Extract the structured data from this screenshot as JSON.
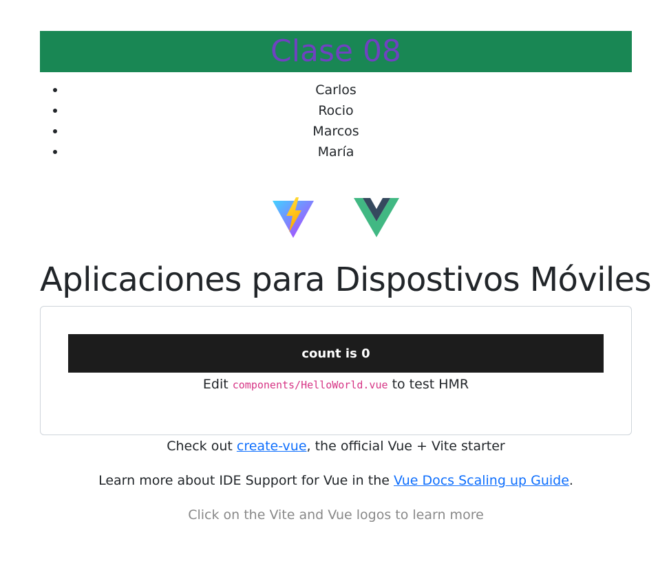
{
  "banner": {
    "title": "Clase 08"
  },
  "names": [
    "Carlos",
    "Rocio",
    "Marcos",
    "María"
  ],
  "logos": [
    {
      "name": "vite-logo"
    },
    {
      "name": "vue-logo"
    }
  ],
  "headline": "Aplicaciones para Dispostivos Móviles",
  "card": {
    "button_label": "count is 0",
    "edit_prefix": "Edit ",
    "edit_code": "components/HelloWorld.vue",
    "edit_suffix": " to test HMR"
  },
  "footer": {
    "check_prefix": "Check out ",
    "check_link": "create-vue",
    "check_suffix": ", the official Vue + Vite starter",
    "learn_prefix": "Learn more about IDE Support for Vue in the ",
    "learn_link": "Vue Docs Scaling up Guide",
    "learn_suffix": ".",
    "hint": "Click on the Vite and Vue logos to learn more"
  },
  "colors": {
    "banner_bg": "#198754",
    "banner_text": "#6f42c1",
    "button_bg": "#1c1c1c",
    "link": "#0d6efd",
    "code": "#d63384",
    "hint": "#888888"
  }
}
